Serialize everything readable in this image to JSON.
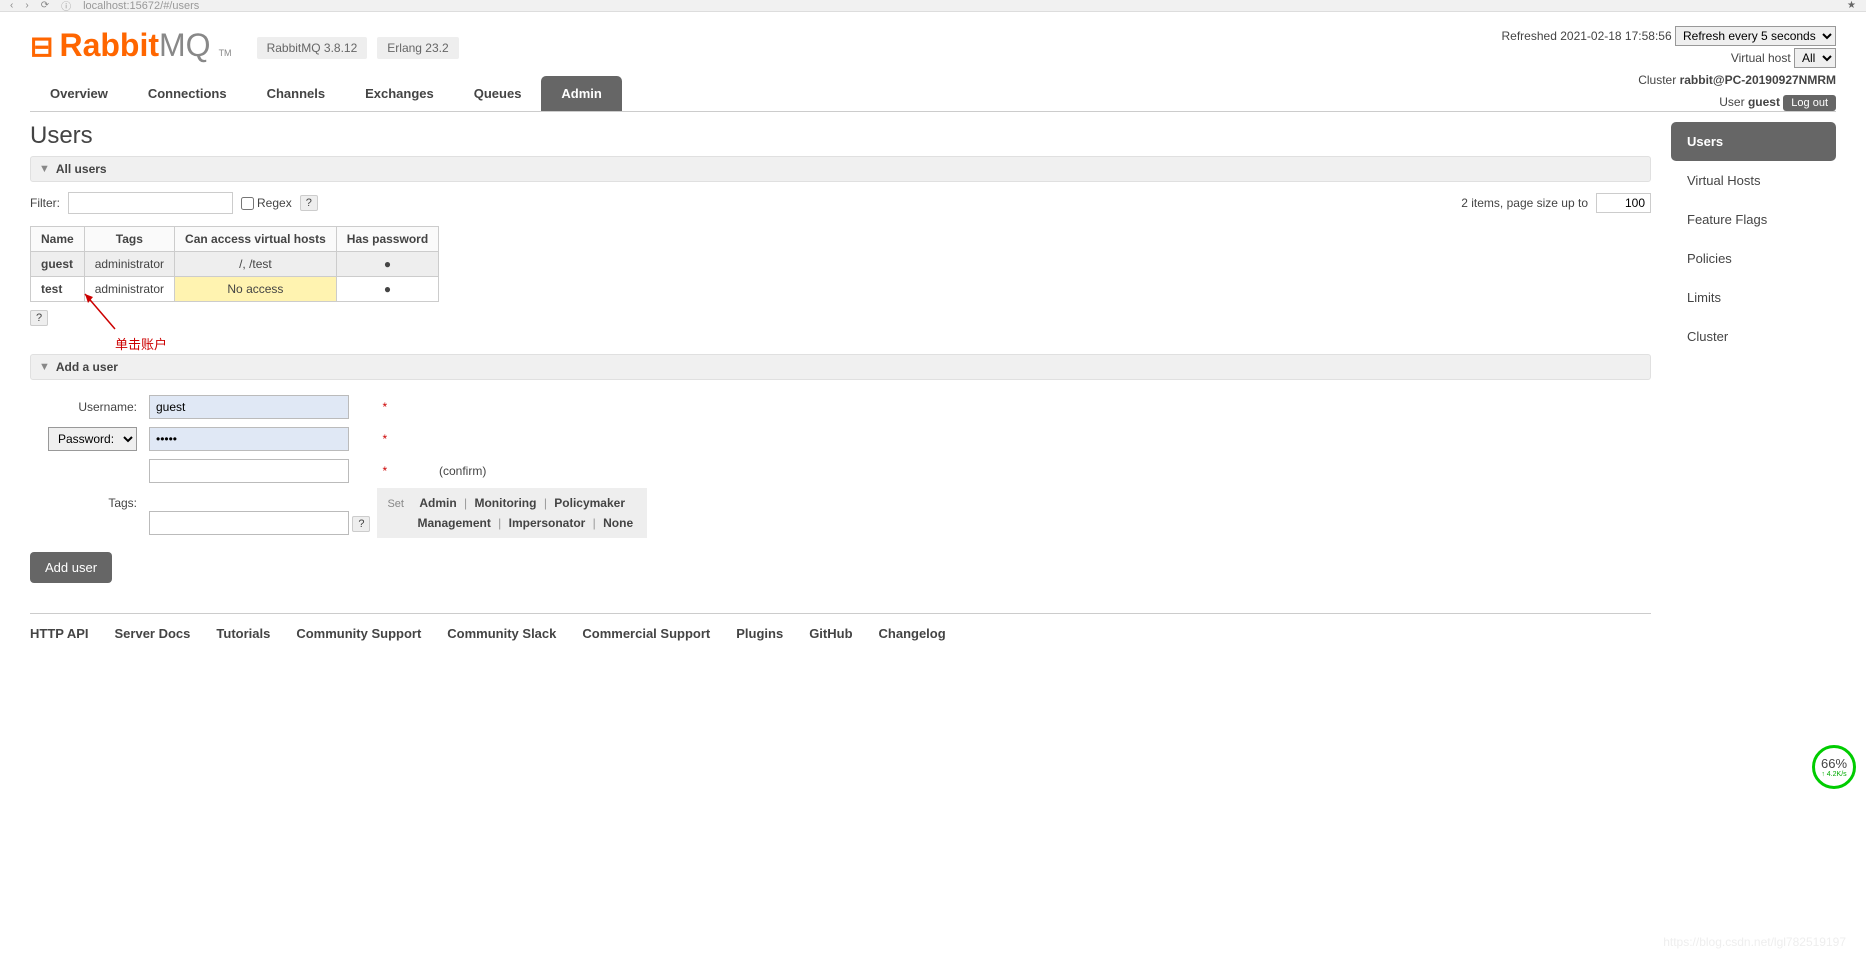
{
  "browser": {
    "url": "localhost:15672/#/users"
  },
  "logo": {
    "brand1": "Rabbit",
    "brand2": "MQ",
    "tm": "TM"
  },
  "versions": {
    "rabbitmq": "RabbitMQ 3.8.12",
    "erlang": "Erlang 23.2"
  },
  "status": {
    "refreshed_label": "Refreshed",
    "refreshed_time": "2021-02-18 17:58:56",
    "refresh_select": "Refresh every 5 seconds",
    "vhost_label": "Virtual host",
    "vhost_value": "All",
    "cluster_label": "Cluster",
    "cluster_value": "rabbit@PC-20190927NMRM",
    "user_label": "User",
    "user_value": "guest",
    "logout": "Log out"
  },
  "tabs": [
    "Overview",
    "Connections",
    "Channels",
    "Exchanges",
    "Queues",
    "Admin"
  ],
  "active_tab": 5,
  "right_nav": [
    "Users",
    "Virtual Hosts",
    "Feature Flags",
    "Policies",
    "Limits",
    "Cluster"
  ],
  "right_nav_active": 0,
  "page_title": "Users",
  "sections": {
    "all_users": "All users",
    "add_user": "Add a user"
  },
  "filter": {
    "label": "Filter:",
    "regex": "Regex",
    "help": "?",
    "items_text": "2 items, page size up to",
    "page_size": "100"
  },
  "table": {
    "headers": [
      "Name",
      "Tags",
      "Can access virtual hosts",
      "Has password"
    ],
    "rows": [
      {
        "name": "guest",
        "tags": "administrator",
        "access": "/, /test",
        "pwd": "●",
        "current": true
      },
      {
        "name": "test",
        "tags": "administrator",
        "access": "No access",
        "pwd": "●",
        "no_access": true
      }
    ]
  },
  "annotation": "单击账户",
  "add_user_form": {
    "username_label": "Username:",
    "username_value": "guest",
    "password_label": "Password:",
    "password_value": "•••••",
    "confirm_label": "(confirm)",
    "tags_label": "Tags:",
    "set": "Set",
    "tag_options_row1": [
      "Admin",
      "Monitoring",
      "Policymaker"
    ],
    "tag_options_row2": [
      "Management",
      "Impersonator",
      "None"
    ],
    "submit": "Add user"
  },
  "footer_links": [
    "HTTP API",
    "Server Docs",
    "Tutorials",
    "Community Support",
    "Community Slack",
    "Commercial Support",
    "Plugins",
    "GitHub",
    "Changelog"
  ],
  "speed": {
    "pct": "66%",
    "rate": "↑ 4.2K/s"
  },
  "watermark": "https://blog.csdn.net/lgl782519197"
}
